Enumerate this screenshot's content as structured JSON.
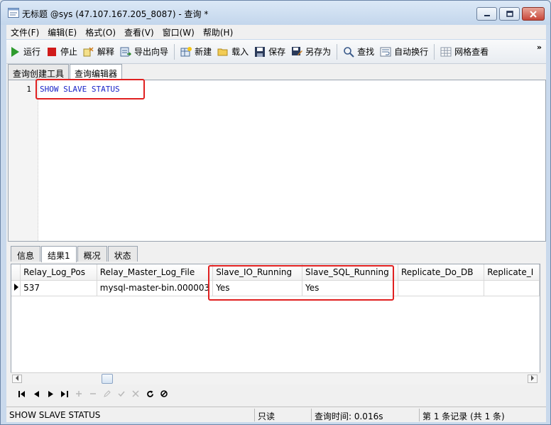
{
  "window": {
    "title": "无标题 @sys (47.107.167.205_8087) - 查询 *"
  },
  "menu": [
    "文件(F)",
    "编辑(E)",
    "格式(O)",
    "查看(V)",
    "窗口(W)",
    "帮助(H)"
  ],
  "toolbar": {
    "run": "运行",
    "stop": "停止",
    "explain": "解释",
    "export_wizard": "导出向导",
    "new": "新建",
    "load": "载入",
    "save": "保存",
    "save_as": "另存为",
    "find": "查找",
    "word_wrap": "自动换行",
    "grid_view": "网格查看",
    "more": "»"
  },
  "query_tabs": [
    "查询创建工具",
    "查询编辑器"
  ],
  "editor": {
    "line_number": "1",
    "code": "SHOW SLAVE STATUS"
  },
  "result_tabs": [
    "信息",
    "结果1",
    "概况",
    "状态"
  ],
  "grid": {
    "columns": [
      "Relay_Log_Pos",
      "Relay_Master_Log_File",
      "Slave_IO_Running",
      "Slave_SQL_Running",
      "Replicate_Do_DB",
      "Replicate_I"
    ],
    "rows": [
      [
        "537",
        "mysql-master-bin.000003",
        "Yes",
        "Yes",
        "",
        ""
      ]
    ]
  },
  "status": {
    "sql": "SHOW SLAVE STATUS",
    "mode": "只读",
    "query_time": "查询时间: 0.016s",
    "records": "第 1 条记录 (共 1 条)"
  },
  "colors": {
    "highlight": "#e02020",
    "keyword": "#1a24c8"
  }
}
